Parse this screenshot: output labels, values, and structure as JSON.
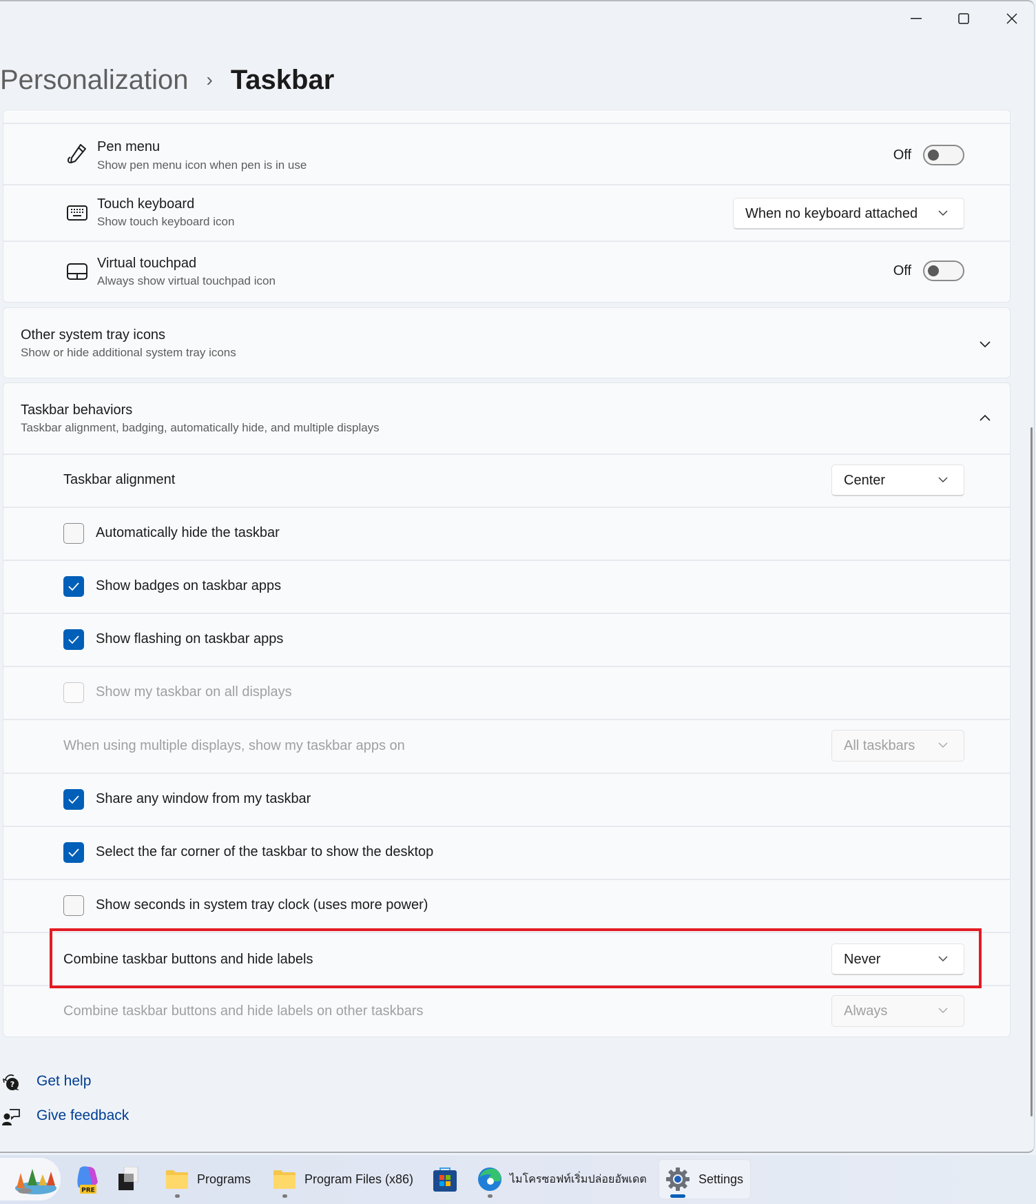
{
  "window": {
    "controls": {
      "minimize": "minimize",
      "maximize": "maximize",
      "close": "close"
    }
  },
  "breadcrumb": {
    "parent": "Personalization",
    "separator": "›",
    "current": "Taskbar"
  },
  "pen_card": {
    "rows": [
      {
        "icon": "pen-icon",
        "title": "Pen menu",
        "subtitle": "Show pen menu icon when pen is in use",
        "control": "toggle",
        "state_label": "Off",
        "on": false
      },
      {
        "icon": "keyboard-icon",
        "title": "Touch keyboard",
        "subtitle": "Show touch keyboard icon",
        "control": "dropdown",
        "value": "When no keyboard attached"
      },
      {
        "icon": "touchpad-icon",
        "title": "Virtual touchpad",
        "subtitle": "Always show virtual touchpad icon",
        "control": "toggle",
        "state_label": "Off",
        "on": false
      }
    ]
  },
  "other_tray": {
    "title": "Other system tray icons",
    "subtitle": "Show or hide additional system tray icons",
    "expanded": false
  },
  "behaviors": {
    "title": "Taskbar behaviors",
    "subtitle": "Taskbar alignment, badging, automatically hide, and multiple displays",
    "expanded": true,
    "alignment": {
      "label": "Taskbar alignment",
      "value": "Center"
    },
    "checkboxes": [
      {
        "label": "Automatically hide the taskbar",
        "checked": false,
        "enabled": true
      },
      {
        "label": "Show badges on taskbar apps",
        "checked": true,
        "enabled": true
      },
      {
        "label": "Show flashing on taskbar apps",
        "checked": true,
        "enabled": true
      },
      {
        "label": "Show my taskbar on all displays",
        "checked": false,
        "enabled": false
      }
    ],
    "multi_display": {
      "label": "When using multiple displays, show my taskbar apps on",
      "value": "All taskbars",
      "enabled": false
    },
    "checkboxes2": [
      {
        "label": "Share any window from my taskbar",
        "checked": true,
        "enabled": true
      },
      {
        "label": "Select the far corner of the taskbar to show the desktop",
        "checked": true,
        "enabled": true
      },
      {
        "label": "Show seconds in system tray clock (uses more power)",
        "checked": false,
        "enabled": true
      }
    ],
    "combine": {
      "label": "Combine taskbar buttons and hide labels",
      "value": "Never",
      "enabled": true,
      "highlighted": true
    },
    "combine_other": {
      "label": "Combine taskbar buttons and hide labels on other taskbars",
      "value": "Always",
      "enabled": false
    }
  },
  "links": {
    "help": "Get help",
    "feedback": "Give feedback"
  },
  "taskbar": {
    "items": [
      {
        "icon": "widgets-landscape-icon",
        "label": ""
      },
      {
        "icon": "copilot-pre-icon",
        "label": "",
        "badge": "PRE"
      },
      {
        "icon": "terminal-icon",
        "label": ""
      },
      {
        "icon": "folder-icon",
        "label": "Programs",
        "running": true
      },
      {
        "icon": "folder-icon",
        "label": "Program Files (x86)",
        "running": true
      },
      {
        "icon": "store-icon",
        "label": ""
      },
      {
        "icon": "edge-icon",
        "label": "ไมโครซอฟท์เริ่มปล่อยอัพเดต",
        "running": true
      },
      {
        "icon": "settings-gear-icon",
        "label": "Settings",
        "active": true
      }
    ]
  },
  "colors": {
    "accent": "#005fb8",
    "link": "#003e92",
    "highlight": "#e31b23"
  }
}
